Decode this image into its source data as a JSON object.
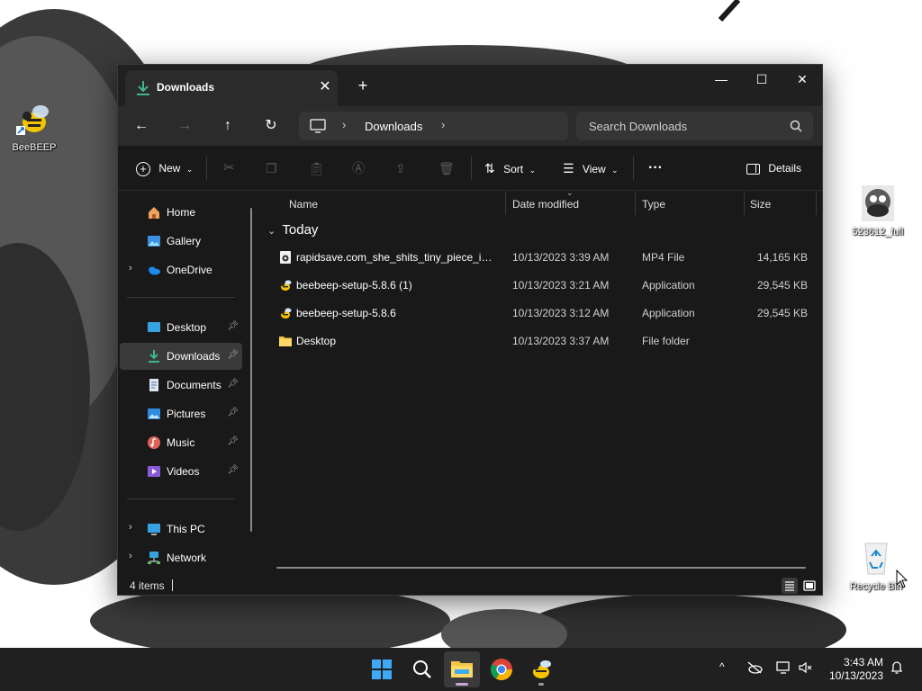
{
  "desktop": {
    "icons": [
      {
        "label": "BeeBEEP",
        "icon": "bee-icon"
      },
      {
        "label": "523612_full",
        "icon": "image-file-icon"
      },
      {
        "label": "Recycle Bin",
        "icon": "recycle-bin-icon"
      }
    ]
  },
  "window": {
    "tab_title": "Downloads",
    "new_tab_label": "+",
    "controls": {
      "minimize": "—",
      "maximize": "☐",
      "close": "✕"
    }
  },
  "navbar": {
    "address_location": "Downloads",
    "search_placeholder": "Search Downloads"
  },
  "toolbar": {
    "new_label": "New",
    "sort_label": "Sort",
    "view_label": "View",
    "more_label": "···",
    "details_label": "Details"
  },
  "sidebar": {
    "items": [
      {
        "label": "Home",
        "icon": "home-icon"
      },
      {
        "label": "Gallery",
        "icon": "gallery-icon"
      },
      {
        "label": "OneDrive",
        "icon": "onedrive-icon"
      },
      {
        "label": "Desktop",
        "icon": "desktop-icon",
        "pinned": true
      },
      {
        "label": "Downloads",
        "icon": "download-icon",
        "pinned": true,
        "selected": true
      },
      {
        "label": "Documents",
        "icon": "documents-icon",
        "pinned": true
      },
      {
        "label": "Pictures",
        "icon": "pictures-icon",
        "pinned": true
      },
      {
        "label": "Music",
        "icon": "music-icon",
        "pinned": true
      },
      {
        "label": "Videos",
        "icon": "videos-icon",
        "pinned": true
      },
      {
        "label": "This PC",
        "icon": "this-pc-icon"
      },
      {
        "label": "Network",
        "icon": "network-icon"
      }
    ]
  },
  "filelist": {
    "columns": {
      "name": "Name",
      "date": "Date modified",
      "type": "Type",
      "size": "Size"
    },
    "group_label": "Today",
    "rows": [
      {
        "name": "rapidsave.com_she_shits_tiny_piece_into...",
        "date": "10/13/2023 3:39 AM",
        "type": "MP4 File",
        "size": "14,165 KB",
        "icon": "video-file-icon"
      },
      {
        "name": "beebeep-setup-5.8.6 (1)",
        "date": "10/13/2023 3:21 AM",
        "type": "Application",
        "size": "29,545 KB",
        "icon": "bee-icon"
      },
      {
        "name": "beebeep-setup-5.8.6",
        "date": "10/13/2023 3:12 AM",
        "type": "Application",
        "size": "29,545 KB",
        "icon": "bee-icon"
      },
      {
        "name": "Desktop",
        "date": "10/13/2023 3:37 AM",
        "type": "File folder",
        "size": "",
        "icon": "folder-icon"
      }
    ]
  },
  "statusbar": {
    "item_count": "4 items"
  },
  "taskbar": {
    "time": "3:43 AM",
    "date": "10/13/2023",
    "tray_chevron": "^"
  },
  "colors": {
    "window_bg": "#191919",
    "titlebar_bg": "#202020",
    "selected_nav_bg": "#3a3a3a",
    "accent_download": "#3fb68b",
    "folder_yellow": "#f4c542"
  }
}
